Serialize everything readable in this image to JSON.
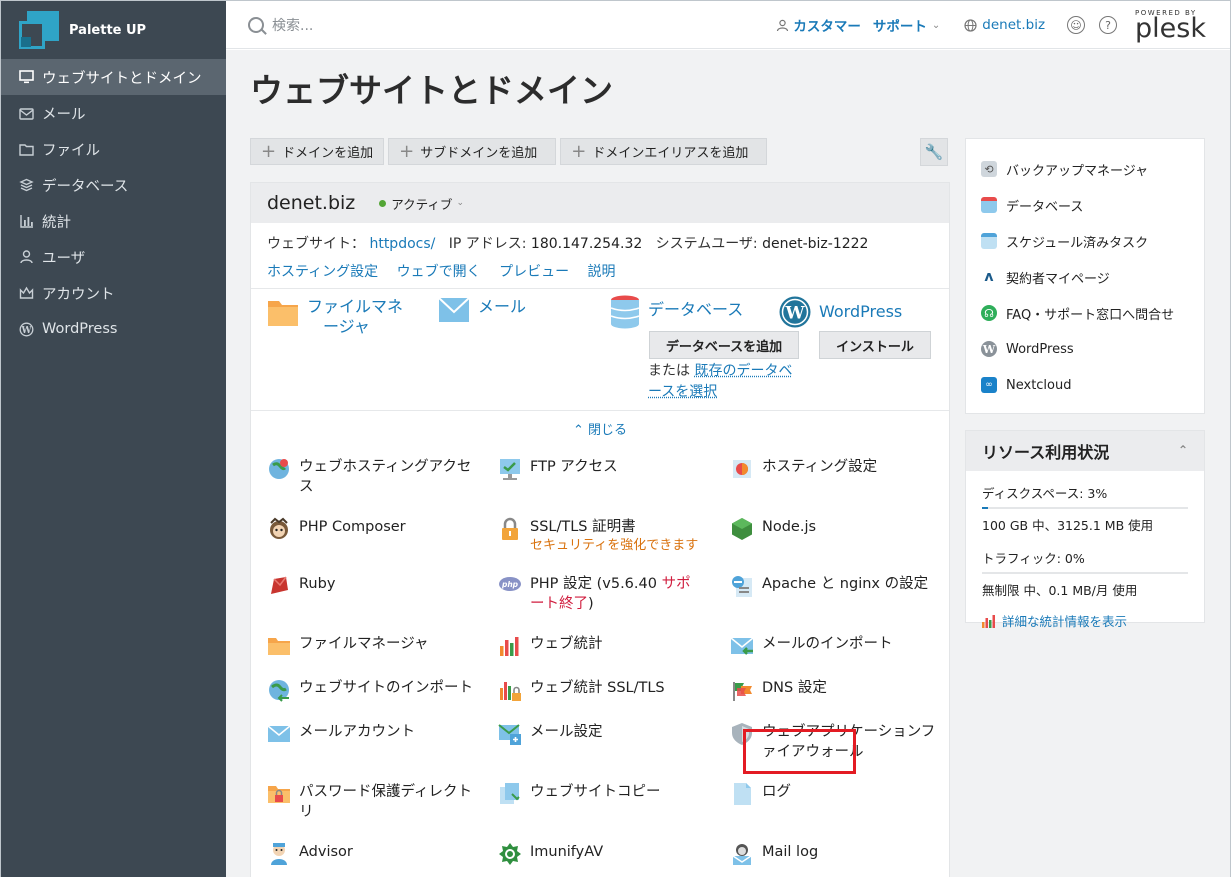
{
  "brand": {
    "name": "Palette UP"
  },
  "sidebar": {
    "items": [
      {
        "label": "ウェブサイトとドメイン",
        "icon": "monitor-icon",
        "active": true
      },
      {
        "label": "メール",
        "icon": "mail-icon"
      },
      {
        "label": "ファイル",
        "icon": "folder-icon"
      },
      {
        "label": "データベース",
        "icon": "database-icon"
      },
      {
        "label": "統計",
        "icon": "stats-icon"
      },
      {
        "label": "ユーザ",
        "icon": "user-icon"
      },
      {
        "label": "アカウント",
        "icon": "crown-icon"
      },
      {
        "label": "WordPress",
        "icon": "wordpress-icon"
      }
    ]
  },
  "topbar": {
    "search_placeholder": "検索...",
    "customer": "カスタマー",
    "support": "サポート",
    "domain": "denet.biz",
    "powered_by": "POWERED BY",
    "plesk": "plesk"
  },
  "page": {
    "title": "ウェブサイトとドメイン"
  },
  "toolbar": {
    "add_domain": "ドメインを追加",
    "add_subdomain": "サブドメインを追加",
    "add_alias": "ドメインエイリアスを追加"
  },
  "domain": {
    "name": "denet.biz",
    "status": "アクティブ",
    "website_label": "ウェブサイト：",
    "docroot": "httpdocs/",
    "ip_label": "IP アドレス:",
    "ip": "180.147.254.32",
    "sysuser_label": "システムユーザ:",
    "sysuser": "denet-biz-1222",
    "links": [
      "ホスティング設定",
      "ウェブで開く",
      "プレビュー",
      "説明"
    ],
    "quick": {
      "file_manager_1": "ファイルマネ",
      "file_manager_2": "ージャ",
      "mail": "メール",
      "database": "データベース",
      "wordpress": "WordPress",
      "add_db": "データベースを追加",
      "install": "インストール",
      "or_text": "または",
      "select_db_1": "既存のデータベ",
      "select_db_2": "ースを選択"
    },
    "collapse": "閉じる"
  },
  "tools": [
    {
      "label": "ウェブホスティングアクセス",
      "icon": "globe-user-icon"
    },
    {
      "label": "FTP アクセス",
      "icon": "ftp-icon"
    },
    {
      "label": "ホスティング設定",
      "icon": "hosting-settings-icon"
    },
    {
      "label": "PHP Composer",
      "icon": "composer-icon"
    },
    {
      "label": "SSL/TLS 証明書",
      "sub": "セキュリティを強化できます",
      "icon": "lock-icon"
    },
    {
      "label": "Node.js",
      "icon": "nodejs-icon"
    },
    {
      "label": "Ruby",
      "icon": "ruby-icon"
    },
    {
      "label": "PHP 設定 (v5.6.40 ",
      "red": "サポート終了",
      "tail": ")",
      "icon": "php-icon"
    },
    {
      "label": "Apache と nginx の設定",
      "icon": "apache-icon"
    },
    {
      "label": "ファイルマネージャ",
      "icon": "folder-icon"
    },
    {
      "label": "ウェブ統計",
      "icon": "bar-chart-icon"
    },
    {
      "label": "メールのインポート",
      "icon": "mail-import-icon"
    },
    {
      "label": "ウェブサイトのインポート",
      "icon": "site-import-icon"
    },
    {
      "label": "ウェブ統計 SSL/TLS",
      "icon": "stats-lock-icon"
    },
    {
      "label": "DNS 設定",
      "icon": "dns-flag-icon"
    },
    {
      "label": "メールアカウント",
      "icon": "mail-icon"
    },
    {
      "label": "メール設定",
      "icon": "mail-settings-icon"
    },
    {
      "label": "ウェブアプリケーションファイアウォール",
      "icon": "shield-icon"
    },
    {
      "label": "パスワード保護ディレクトリ",
      "icon": "locked-folder-icon"
    },
    {
      "label": "ウェブサイトコピー",
      "icon": "copy-icon"
    },
    {
      "label": "ログ",
      "icon": "log-icon"
    },
    {
      "label": "Advisor",
      "icon": "advisor-icon"
    },
    {
      "label": "ImunifyAV",
      "icon": "imunify-icon"
    },
    {
      "label": "Mail log",
      "icon": "mail-log-icon"
    }
  ],
  "side_links": [
    {
      "label": "バックアップマネージャ",
      "icon": "backup-icon"
    },
    {
      "label": "データベース",
      "icon": "database-icon"
    },
    {
      "label": "スケジュール済みタスク",
      "icon": "calendar-icon"
    },
    {
      "label": "契約者マイページ",
      "icon": "mypage-icon"
    },
    {
      "label": "FAQ・サポート窓口へ問合せ",
      "icon": "headset-icon"
    },
    {
      "label": "WordPress",
      "icon": "wordpress-icon"
    },
    {
      "label": "Nextcloud",
      "icon": "nextcloud-icon"
    }
  ],
  "resources": {
    "title": "リソース利用状況",
    "disk_label": "ディスクスペース: 3%",
    "disk_percent": 3,
    "disk_detail": "100 GB 中、3125.1 MB 使用",
    "traffic_label": "トラフィック: 0%",
    "traffic_percent": 0,
    "traffic_detail": "無制限 中、0.1 MB/月 使用",
    "details_link": "詳細な統計情報を表示"
  }
}
